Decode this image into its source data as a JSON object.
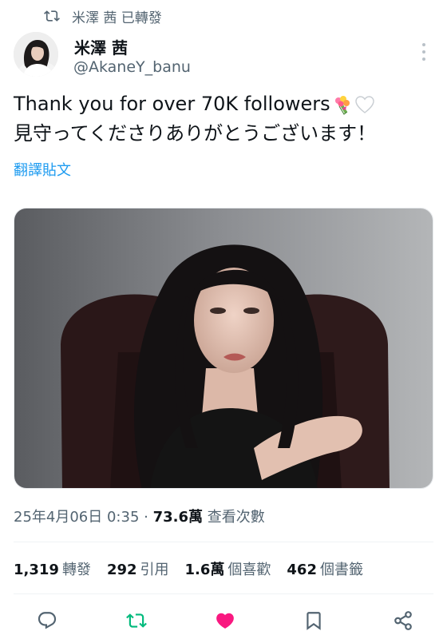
{
  "retweet_banner": {
    "text": "米澤 茜 已轉發",
    "icon": "retweet-icon"
  },
  "author": {
    "name": "米澤 茜",
    "handle": "@AkaneY_banu"
  },
  "tweet": {
    "line1": "Thank you for over 70K followers",
    "line2": "見守ってくださりありがとうございます！",
    "emojis": [
      "bouquet-emoji",
      "white-heart-emoji"
    ]
  },
  "translate_label": "翻譯貼文",
  "meta": {
    "timestamp": "25年4月06日 0:35 · ",
    "views": "73.6萬",
    "views_label": " 查看次數"
  },
  "stats": [
    {
      "count": "1,319",
      "label": "轉發"
    },
    {
      "count": "292",
      "label": "引用"
    },
    {
      "count": "1.6萬",
      "label": "個喜歡"
    },
    {
      "count": "462",
      "label": "個書籤"
    }
  ],
  "actions": [
    "reply-icon",
    "retweet-icon",
    "like-icon",
    "bookmark-icon",
    "share-icon"
  ],
  "colors": {
    "accent": "#1d9bf0",
    "retweeted": "#00ba7c",
    "liked": "#f91880",
    "secondary": "#536471"
  }
}
